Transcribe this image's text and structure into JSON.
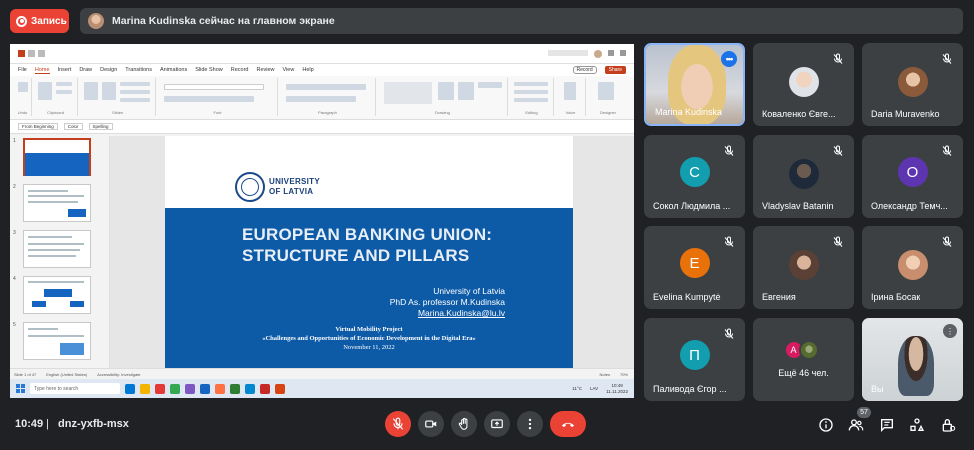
{
  "top_bar": {
    "record_label": "Запись",
    "presenter_text": "Marina Kudinska сейчас на главном экране"
  },
  "shared_screen": {
    "ppt_menu": [
      "File",
      "Home",
      "Insert",
      "Draw",
      "Design",
      "Transitions",
      "Animations",
      "Slide Show",
      "Record",
      "Review",
      "View",
      "Help"
    ],
    "ppt_active_tab": "Home",
    "ppt_record": "Record",
    "ppt_share": "Share",
    "ppt_sub": [
      "From Beginning",
      "Color",
      "Spelling"
    ],
    "ribbon_groups": [
      "Undo",
      "Clipboard",
      "Slides",
      "Font",
      "Paragraph",
      "Drawing",
      "Editing",
      "Voice",
      "Designer"
    ],
    "slide": {
      "university_line1": "UNIVERSITY",
      "university_line2": "OF LATVIA",
      "title_line1": "EUROPEAN BANKING UNION:",
      "title_line2": "STRUCTURE AND PILLARS",
      "author_line1": "University of Latvia",
      "author_line2": "PhD As. professor M.Kudinska",
      "author_email": "Marina.Kudinska@lu.lv",
      "project_line1": "Virtual Mobility Project",
      "project_line2": "«Challenges and Opportunities of Economic Development in the Digital Era»",
      "project_date": "November 11, 2022"
    },
    "thumb_numbers": [
      "1",
      "2",
      "3",
      "4",
      "5"
    ],
    "status_items": [
      "Slide 1 of 47",
      "English (United States)",
      "Accessibility: Investigate",
      "Notes",
      "70%"
    ],
    "taskbar": {
      "search_placeholder": "Type here to search",
      "weather": "11°C",
      "lang": "LAV",
      "clock_time": "10:49",
      "clock_date": "11.11.2022"
    }
  },
  "participants": [
    {
      "name": "Marina Kudinska",
      "type": "video-speaker"
    },
    {
      "name": "Коваленко Євге...",
      "type": "photo",
      "color": "#dfe3e8"
    },
    {
      "name": "Daria Muravenko",
      "type": "photo",
      "color": "#c79b7a"
    },
    {
      "name": "Сокол Людмила ...",
      "type": "letter",
      "letter": "С",
      "color": "#129eaf"
    },
    {
      "name": "Vladyslav Batanin",
      "type": "photo",
      "color": "#1e2a3a"
    },
    {
      "name": "Олександр Темч...",
      "type": "letter",
      "letter": "О",
      "color": "#5e35b1"
    },
    {
      "name": "Evelina Kumpytė",
      "type": "letter",
      "letter": "E",
      "color": "#e8710a"
    },
    {
      "name": "Евгения",
      "type": "photo",
      "color": "#a2806a"
    },
    {
      "name": "Ірина Босак",
      "type": "photo",
      "color": "#c88e6e"
    },
    {
      "name": "Паливода Єгор ...",
      "type": "letter",
      "letter": "П",
      "color": "#129eaf"
    },
    {
      "name": "Ещё 46 чел.",
      "type": "more",
      "letter": "А",
      "color": "#d81b60"
    },
    {
      "name": "Вы",
      "type": "video-self"
    }
  ],
  "bottom_bar": {
    "time": "10:49",
    "separator": "|",
    "meeting_code": "dnz-yxfb-msx",
    "people_count": "57"
  },
  "colors": {
    "background": "#202124",
    "tile": "#3c4043",
    "danger": "#ea4335",
    "accent": "#8ab4f8",
    "slide_blue": "#0d5aa7"
  },
  "icons": [
    "record-icon",
    "mic-off-icon",
    "camera-icon",
    "raise-hand-icon",
    "present-icon",
    "more-vert-icon",
    "end-call-icon",
    "info-icon",
    "people-icon",
    "chat-icon",
    "activities-icon",
    "host-controls-icon"
  ]
}
